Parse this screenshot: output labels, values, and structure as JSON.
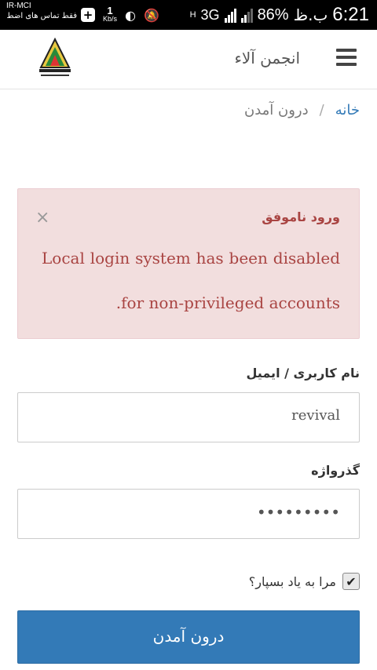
{
  "statusbar": {
    "carrier": "IR-MCI",
    "notification": "فقط تماس های اضط...",
    "speed_value": "1",
    "speed_unit": "Kb/s",
    "network": "H",
    "network_type": "3G",
    "battery": "86%",
    "ampm": "ب.ظ",
    "time": "6:21"
  },
  "header": {
    "site_title": "انجمن آلاء",
    "menu_icon": "hamburger-menu-icon",
    "logo_icon": "site-logo"
  },
  "breadcrumb": {
    "home": "خانه",
    "separator": "/",
    "current": "درون آمدن"
  },
  "alert": {
    "title": "ورود ناموفق",
    "message": "Local login system has been disabled for non-privileged accounts.",
    "close": "×",
    "bg_color": "#f2dede",
    "text_color": "#a94442"
  },
  "form": {
    "username_label": "نام کاربری / ایمیل",
    "username_value": "revival",
    "password_label": "گذرواژه",
    "password_value": "•••••••••",
    "remember_label": "مرا به یاد بسپار؟",
    "remember_checked": true,
    "submit_label": "درون آمدن",
    "submit_color": "#337ab7"
  }
}
